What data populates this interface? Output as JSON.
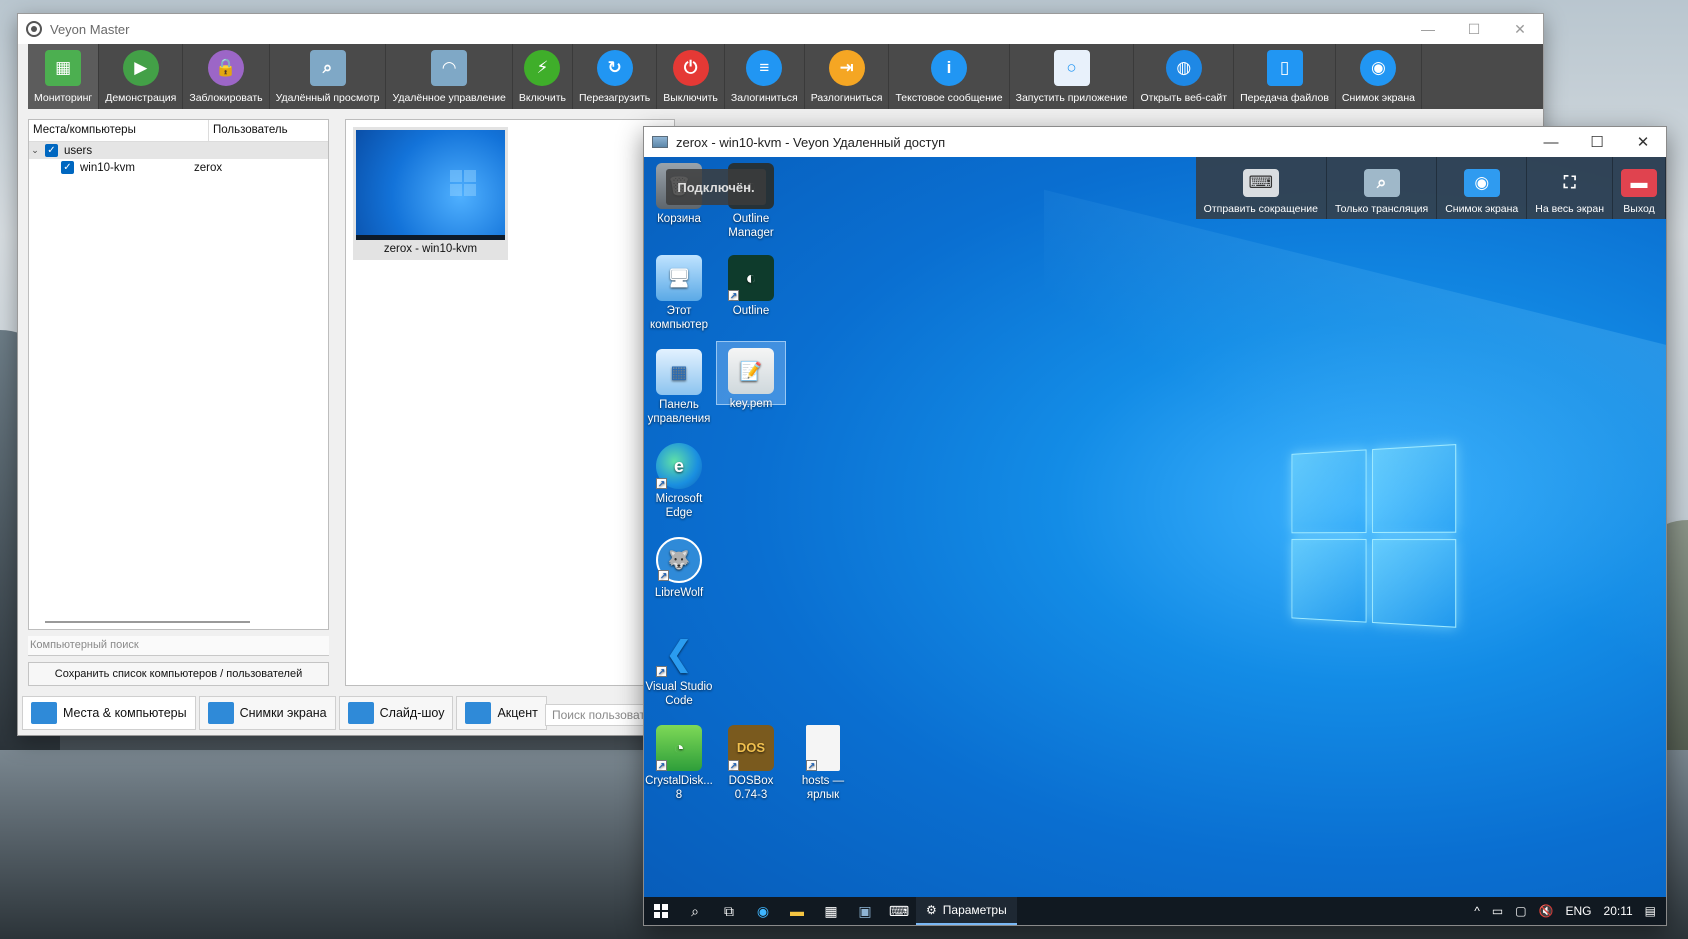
{
  "master": {
    "title": "Veyon Master",
    "toolbar": [
      {
        "label": "Мониторинг",
        "icon": "monitoring-icon",
        "color": "#4caf50",
        "active": true
      },
      {
        "label": "Демонстрация",
        "icon": "presentation-icon",
        "color": "#43a047"
      },
      {
        "label": "Заблокировать",
        "icon": "lock-icon",
        "color": "#9c66c7"
      },
      {
        "label": "Удалённый просмотр",
        "icon": "remote-view-icon",
        "color": "#7fa8c6"
      },
      {
        "label": "Удалённое управление",
        "icon": "remote-control-icon",
        "color": "#7fa8c6"
      },
      {
        "label": "Включить",
        "icon": "power-on-icon",
        "color": "#3fae2a"
      },
      {
        "label": "Перезагрузить",
        "icon": "reboot-icon",
        "color": "#2196f3"
      },
      {
        "label": "Выключить",
        "icon": "power-off-icon",
        "color": "#e53935"
      },
      {
        "label": "Залогиниться",
        "icon": "login-icon",
        "color": "#2196f3"
      },
      {
        "label": "Разлогиниться",
        "icon": "logout-icon",
        "color": "#f5a623"
      },
      {
        "label": "Текстовое сообщение",
        "icon": "message-icon",
        "color": "#2196f3"
      },
      {
        "label": "Запустить приложение",
        "icon": "run-app-icon",
        "color": "#e8f1fb"
      },
      {
        "label": "Открыть веб-сайт",
        "icon": "globe-icon",
        "color": "#1e88e5"
      },
      {
        "label": "Передача файлов",
        "icon": "file-transfer-icon",
        "color": "#2196f3"
      },
      {
        "label": "Снимок экрана",
        "icon": "screenshot-icon",
        "color": "#2196f3"
      }
    ],
    "tree": {
      "col_locations": "Места/компьютеры",
      "col_user": "Пользователь",
      "group": "users",
      "computer": "win10-kvm",
      "computer_user": "zerox"
    },
    "search_placeholder": "Компьютерный поиск",
    "save_button": "Сохранить список компьютеров / пользователей",
    "tile_label": "zerox - win10-kvm",
    "bottom_tabs": [
      {
        "label": "Места & компьютеры",
        "icon": "computers-icon",
        "active": true
      },
      {
        "label": "Снимки экрана",
        "icon": "screenshots-icon"
      },
      {
        "label": "Слайд-шоу",
        "icon": "slideshow-icon"
      },
      {
        "label": "Акцент",
        "icon": "spotlight-icon"
      }
    ],
    "user_search_placeholder": "Поиск пользовате"
  },
  "remote": {
    "title": "zerox - win10-kvm - Veyon Удаленный доступ",
    "status": "Подключён.",
    "toolbar": [
      {
        "label": "Отправить сокращение",
        "icon": "keyboard-icon"
      },
      {
        "label": "Только трансляция",
        "icon": "view-only-icon"
      },
      {
        "label": "Снимок экрана",
        "icon": "screenshot-icon"
      },
      {
        "label": "На весь экран",
        "icon": "fullscreen-icon"
      },
      {
        "label": "Выход",
        "icon": "exit-icon"
      }
    ],
    "desktop_icons": {
      "recycle": "Корзина",
      "outline_manager": "Outline Manager",
      "this_pc": "Этот компьютер",
      "outline": "Outline",
      "control_panel": "Панель управления",
      "keypem": "key.pem",
      "edge": "Microsoft Edge",
      "librewolf": "LibreWolf",
      "vscode": "Visual Studio Code",
      "crystaldisk": "CrystalDisk... 8",
      "dosbox": "DOSBox 0.74-3",
      "hosts": "hosts — ярлык"
    },
    "taskbar": {
      "active_app": "Параметры",
      "lang": "ENG",
      "time": "20:11"
    }
  }
}
